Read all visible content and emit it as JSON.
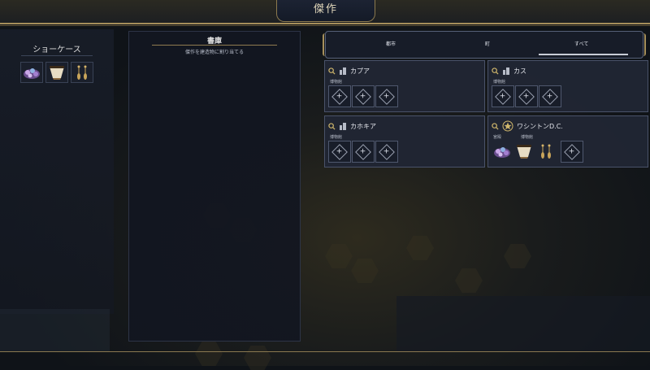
{
  "header": {
    "title": "傑作"
  },
  "showcase": {
    "title": "ショーケース",
    "items": [
      {
        "name": "gems-icon"
      },
      {
        "name": "cup-icon"
      },
      {
        "name": "earrings-icon"
      }
    ]
  },
  "library": {
    "title": "書庫",
    "subtitle": "傑作を建造物に割り当てる"
  },
  "tabs": {
    "city": "都市",
    "town": "町",
    "all": "すべて",
    "selected": "すべて"
  },
  "cities": [
    {
      "name": "カプア",
      "building": "博物館",
      "slot_count": 3
    },
    {
      "name": "カス",
      "building": "博物館",
      "slot_count": 3
    },
    {
      "name": "カホキア",
      "building": "博物館",
      "slot_count": 3
    },
    {
      "name": "ワシントンD.C.",
      "building": "宮殿",
      "building2": "博物館",
      "slot_count": 1,
      "filled": [
        "gems-icon",
        "cup-icon",
        "earrings-icon"
      ]
    }
  ],
  "colors": {
    "accent_gold": "#a68f5b",
    "panel": "#212634",
    "border": "#495269"
  }
}
